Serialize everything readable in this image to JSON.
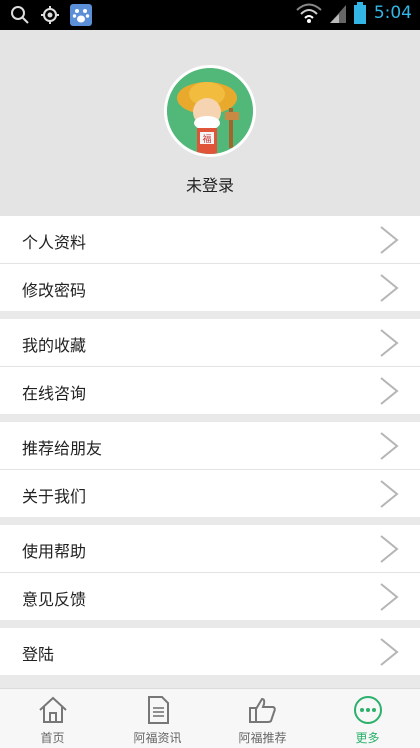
{
  "status_bar": {
    "time": "5:04"
  },
  "profile": {
    "name": "未登录"
  },
  "menu": {
    "items": [
      {
        "label": "个人资料"
      },
      {
        "label": "修改密码"
      },
      {
        "label": "我的收藏"
      },
      {
        "label": "在线咨询"
      },
      {
        "label": "推荐给朋友"
      },
      {
        "label": "关于我们"
      },
      {
        "label": "使用帮助"
      },
      {
        "label": "意见反馈"
      },
      {
        "label": "登陆"
      }
    ]
  },
  "tabs": [
    {
      "label": "首页",
      "icon": "home-icon"
    },
    {
      "label": "阿福资讯",
      "icon": "news-icon"
    },
    {
      "label": "阿福推荐",
      "icon": "thumbs-up-icon"
    },
    {
      "label": "更多",
      "icon": "more-icon",
      "active": true
    }
  ],
  "colors": {
    "accent": "#2bb16b",
    "time": "#33b5e5"
  }
}
